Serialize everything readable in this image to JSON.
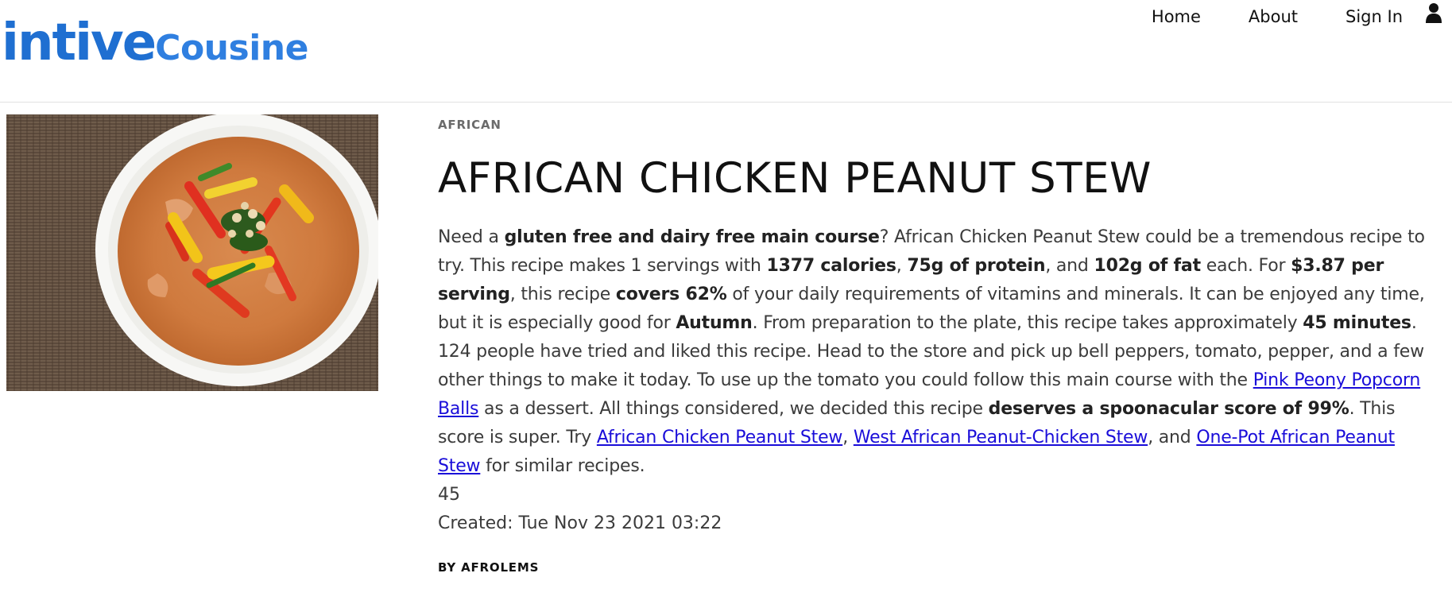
{
  "brand": {
    "part1": "intive",
    "part2": "Cousine"
  },
  "nav": {
    "home": "Home",
    "about": "About",
    "sign_in": "Sign In"
  },
  "recipe": {
    "category": "AFRICAN",
    "title": "AFRICAN CHICKEN PEANUT STEW",
    "summary": {
      "s01": "Need a ",
      "b01": "gluten free and dairy free main course",
      "s02": "? African Chicken Peanut Stew could be a tremendous recipe to try. This recipe makes 1 servings with ",
      "b02": "1377 calories",
      "s03": ", ",
      "b03": "75g of protein",
      "s04": ", and ",
      "b04": "102g of fat",
      "s05": " each. For ",
      "b05": "$3.87 per serving",
      "s06": ", this recipe ",
      "b06": "covers 62%",
      "s07": " of your daily requirements of vitamins and minerals. It can be enjoyed any time, but it is especially good for ",
      "b07": "Autumn",
      "s08": ". From preparation to the plate, this recipe takes approximately ",
      "b08": "45 minutes",
      "s09": ". 124 people have tried and liked this recipe. Head to the store and pick up bell peppers, tomato, pepper, and a few other things to make it today. To use up the tomato you could follow this main course with the ",
      "l01": "Pink Peony Popcorn Balls",
      "s10": " as a dessert. All things considered, we decided this recipe ",
      "b09": "deserves a spoonacular score of 99%",
      "s11": ". This score is super. Try ",
      "l02": "African Chicken Peanut Stew",
      "s12": ", ",
      "l03": "West African Peanut-Chicken Stew",
      "s13": ", and ",
      "l04": "One-Pot African Peanut Stew",
      "s14": " for similar recipes."
    },
    "ready_minutes": "45",
    "created": "Created: Tue Nov 23 2021 03:22",
    "author": "BY AFROLEMS"
  },
  "colors": {
    "brand_blue": "#1f6fd1",
    "link": "#1a0dd9"
  },
  "icons": {
    "user": "user-icon"
  }
}
